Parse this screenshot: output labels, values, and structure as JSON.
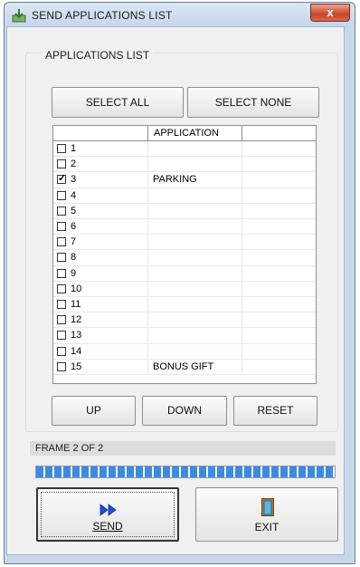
{
  "window": {
    "title": "SEND APPLICATIONS LIST",
    "close_label": "x"
  },
  "group": {
    "label": "APPLICATIONS LIST"
  },
  "buttons": {
    "select_all": "SELECT ALL",
    "select_none": "SELECT NONE",
    "up": "UP",
    "down": "DOWN",
    "reset": "RESET",
    "send": "SEND",
    "exit": "EXIT"
  },
  "list": {
    "columns": [
      "",
      "APPLICATION",
      ""
    ],
    "rows": [
      {
        "num": "1",
        "checked": false,
        "app": ""
      },
      {
        "num": "2",
        "checked": false,
        "app": ""
      },
      {
        "num": "3",
        "checked": true,
        "app": "PARKING"
      },
      {
        "num": "4",
        "checked": false,
        "app": ""
      },
      {
        "num": "5",
        "checked": false,
        "app": ""
      },
      {
        "num": "6",
        "checked": false,
        "app": ""
      },
      {
        "num": "7",
        "checked": false,
        "app": ""
      },
      {
        "num": "8",
        "checked": false,
        "app": ""
      },
      {
        "num": "9",
        "checked": false,
        "app": ""
      },
      {
        "num": "10",
        "checked": false,
        "app": ""
      },
      {
        "num": "11",
        "checked": false,
        "app": ""
      },
      {
        "num": "12",
        "checked": false,
        "app": ""
      },
      {
        "num": "13",
        "checked": false,
        "app": ""
      },
      {
        "num": "14",
        "checked": false,
        "app": ""
      },
      {
        "num": "15",
        "checked": false,
        "app": "BONUS GIFT"
      }
    ]
  },
  "status": {
    "frame_text": "FRAME 2 OF 2",
    "progress_fraction": 1.0
  },
  "colors": {
    "progress": "#3c8be0",
    "send_icon": "#1f4fd6"
  },
  "icons": {
    "title": "download-app-icon",
    "send": "fast-forward-icon",
    "exit": "door-icon"
  }
}
